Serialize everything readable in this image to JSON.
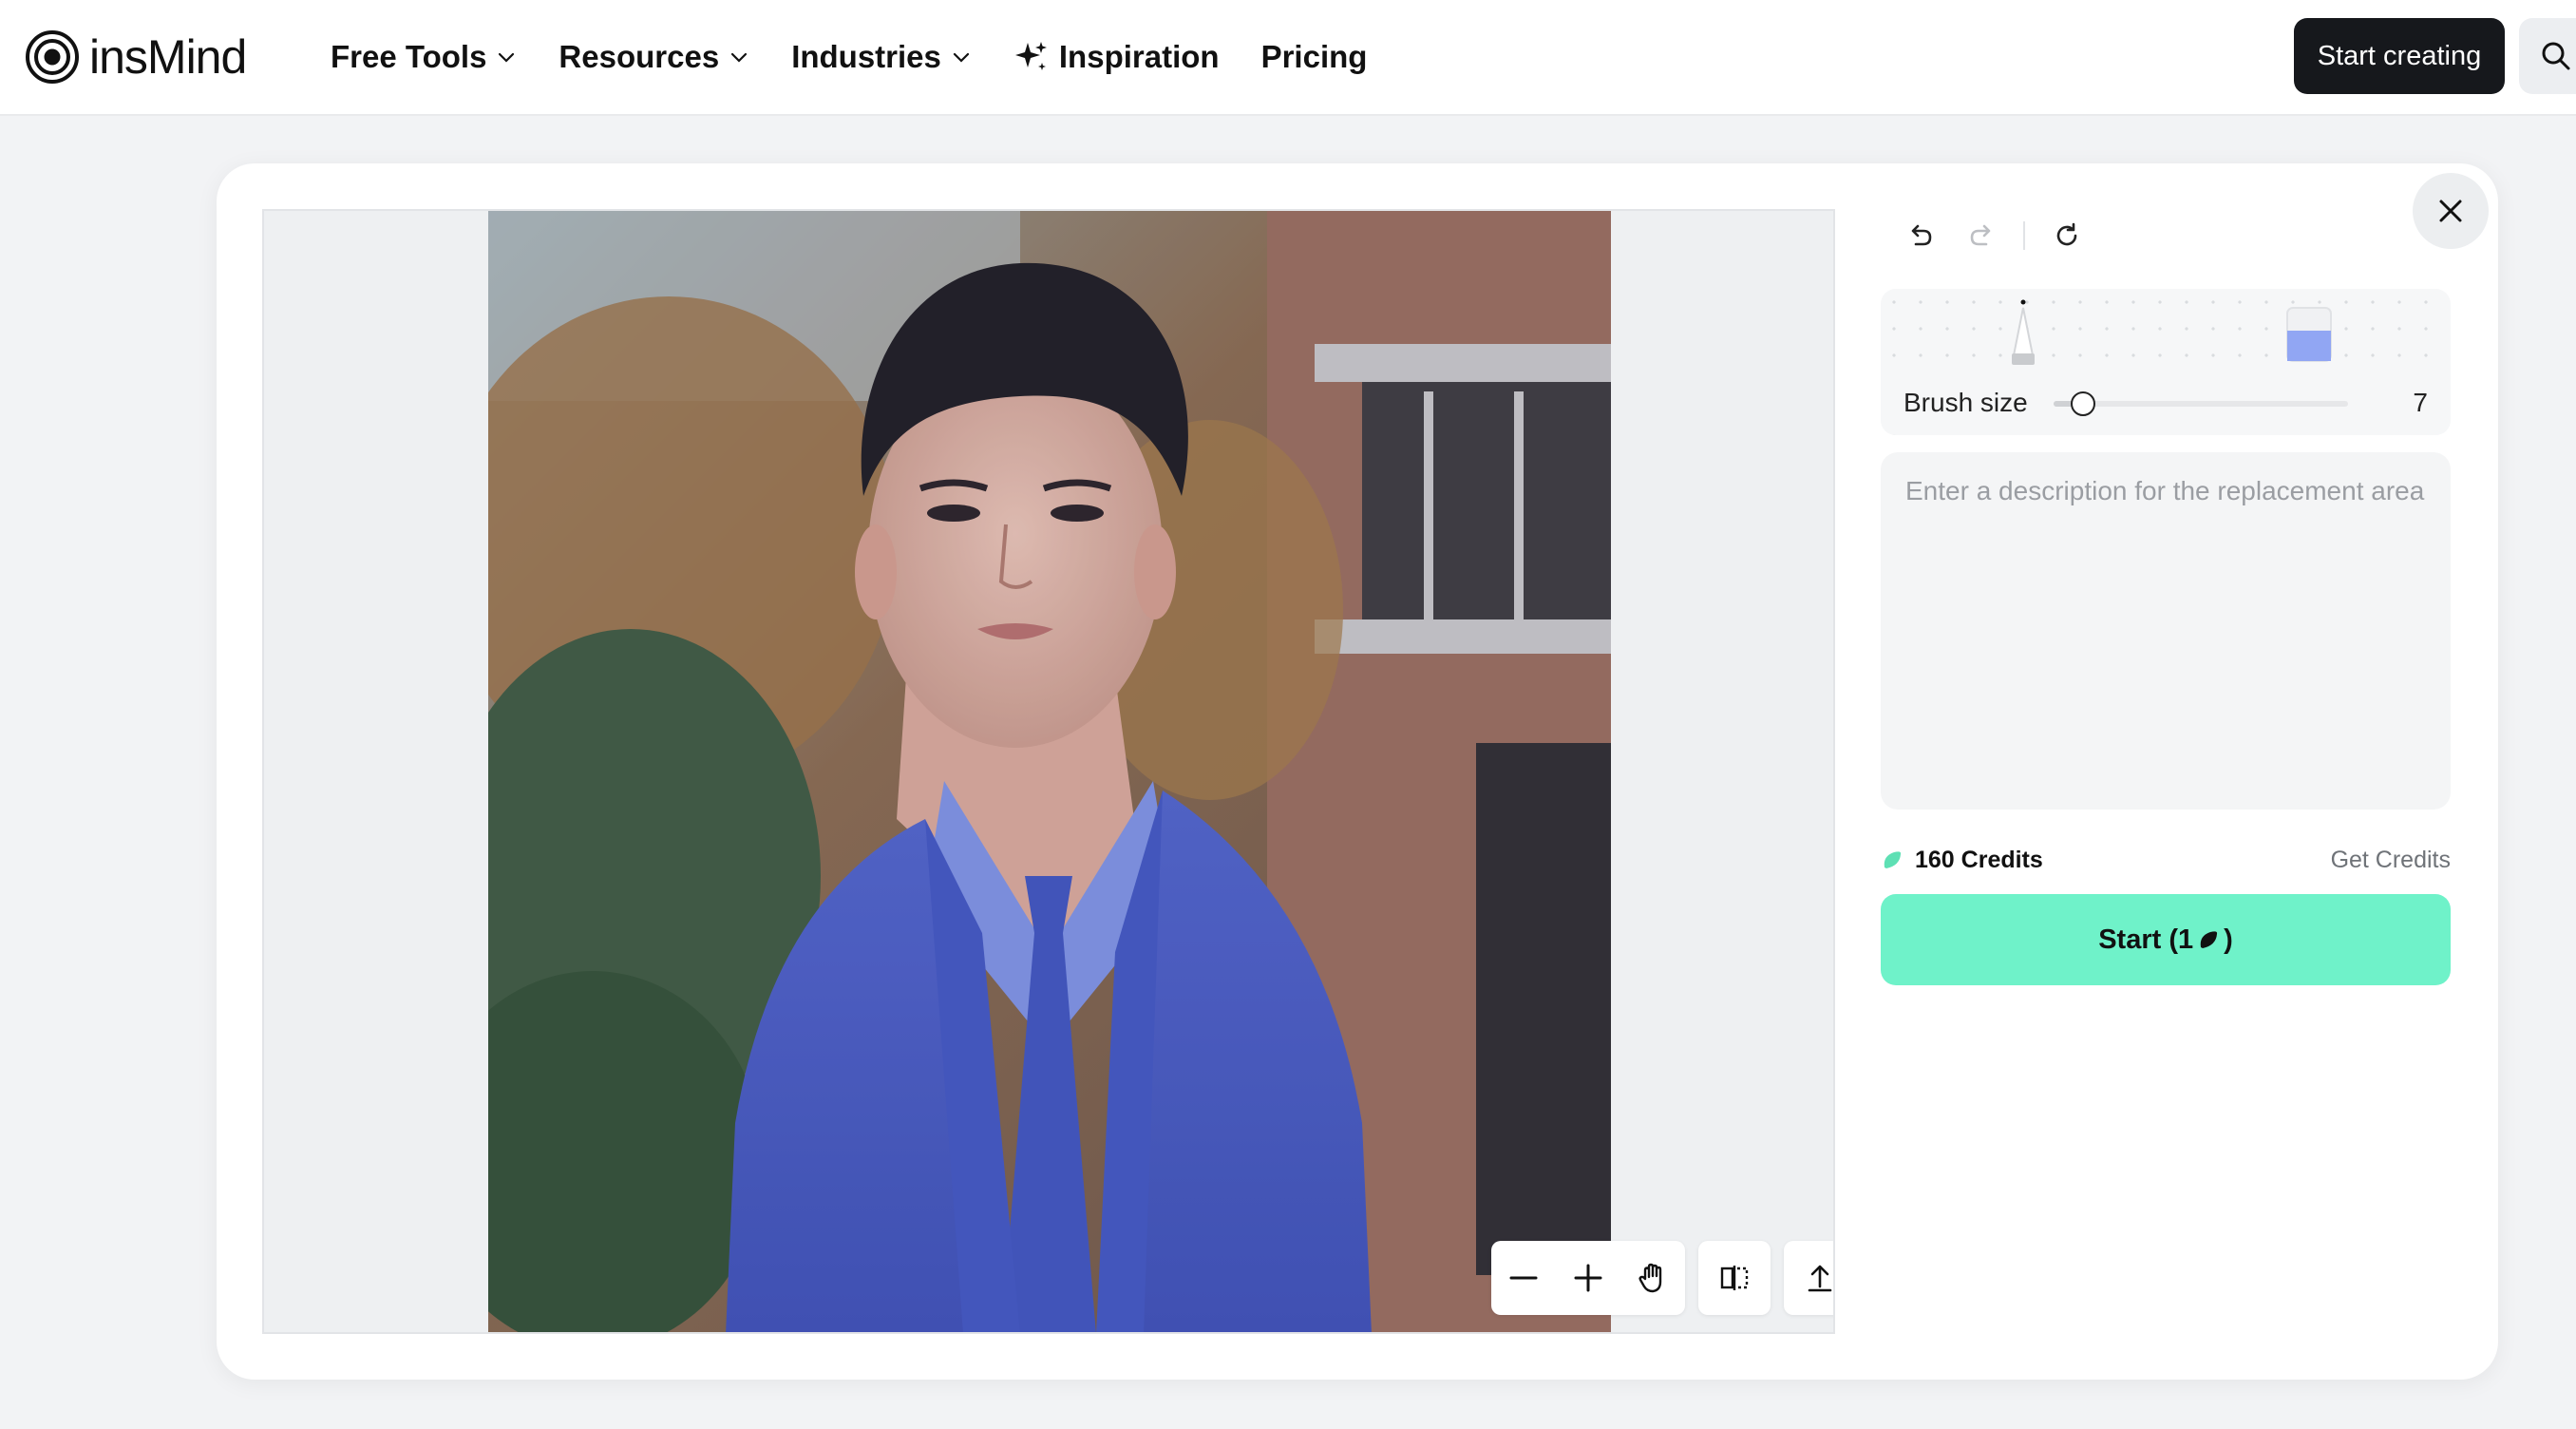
{
  "header": {
    "logo_text": "insMind",
    "nav": [
      {
        "label": "Free Tools",
        "has_dropdown": true
      },
      {
        "label": "Resources",
        "has_dropdown": true
      },
      {
        "label": "Industries",
        "has_dropdown": true
      },
      {
        "label": "Inspiration",
        "icon": "sparkle-icon"
      },
      {
        "label": "Pricing"
      }
    ],
    "cta_label": "Start creating",
    "search_icon": "search-icon"
  },
  "editor": {
    "canvas_tools": [
      "zoom-out-icon",
      "zoom-in-icon",
      "hand-pan-icon",
      "compare-icon",
      "upload-icon"
    ],
    "history": [
      "undo-icon",
      "redo-icon",
      "reset-icon"
    ],
    "brush": {
      "label": "Brush size",
      "value": "7",
      "tools": [
        "pencil-icon",
        "eraser-icon"
      ]
    },
    "description": {
      "placeholder": "Enter a description for the replacement area",
      "value": ""
    },
    "credits": {
      "label": "160 Credits",
      "get_label": "Get Credits"
    },
    "start": {
      "prefix": "Start (1",
      "suffix": ")"
    }
  },
  "colors": {
    "accent": "#6ff2c9",
    "cta_dark": "#16181c",
    "mask_blue": "#4a5fc9"
  }
}
